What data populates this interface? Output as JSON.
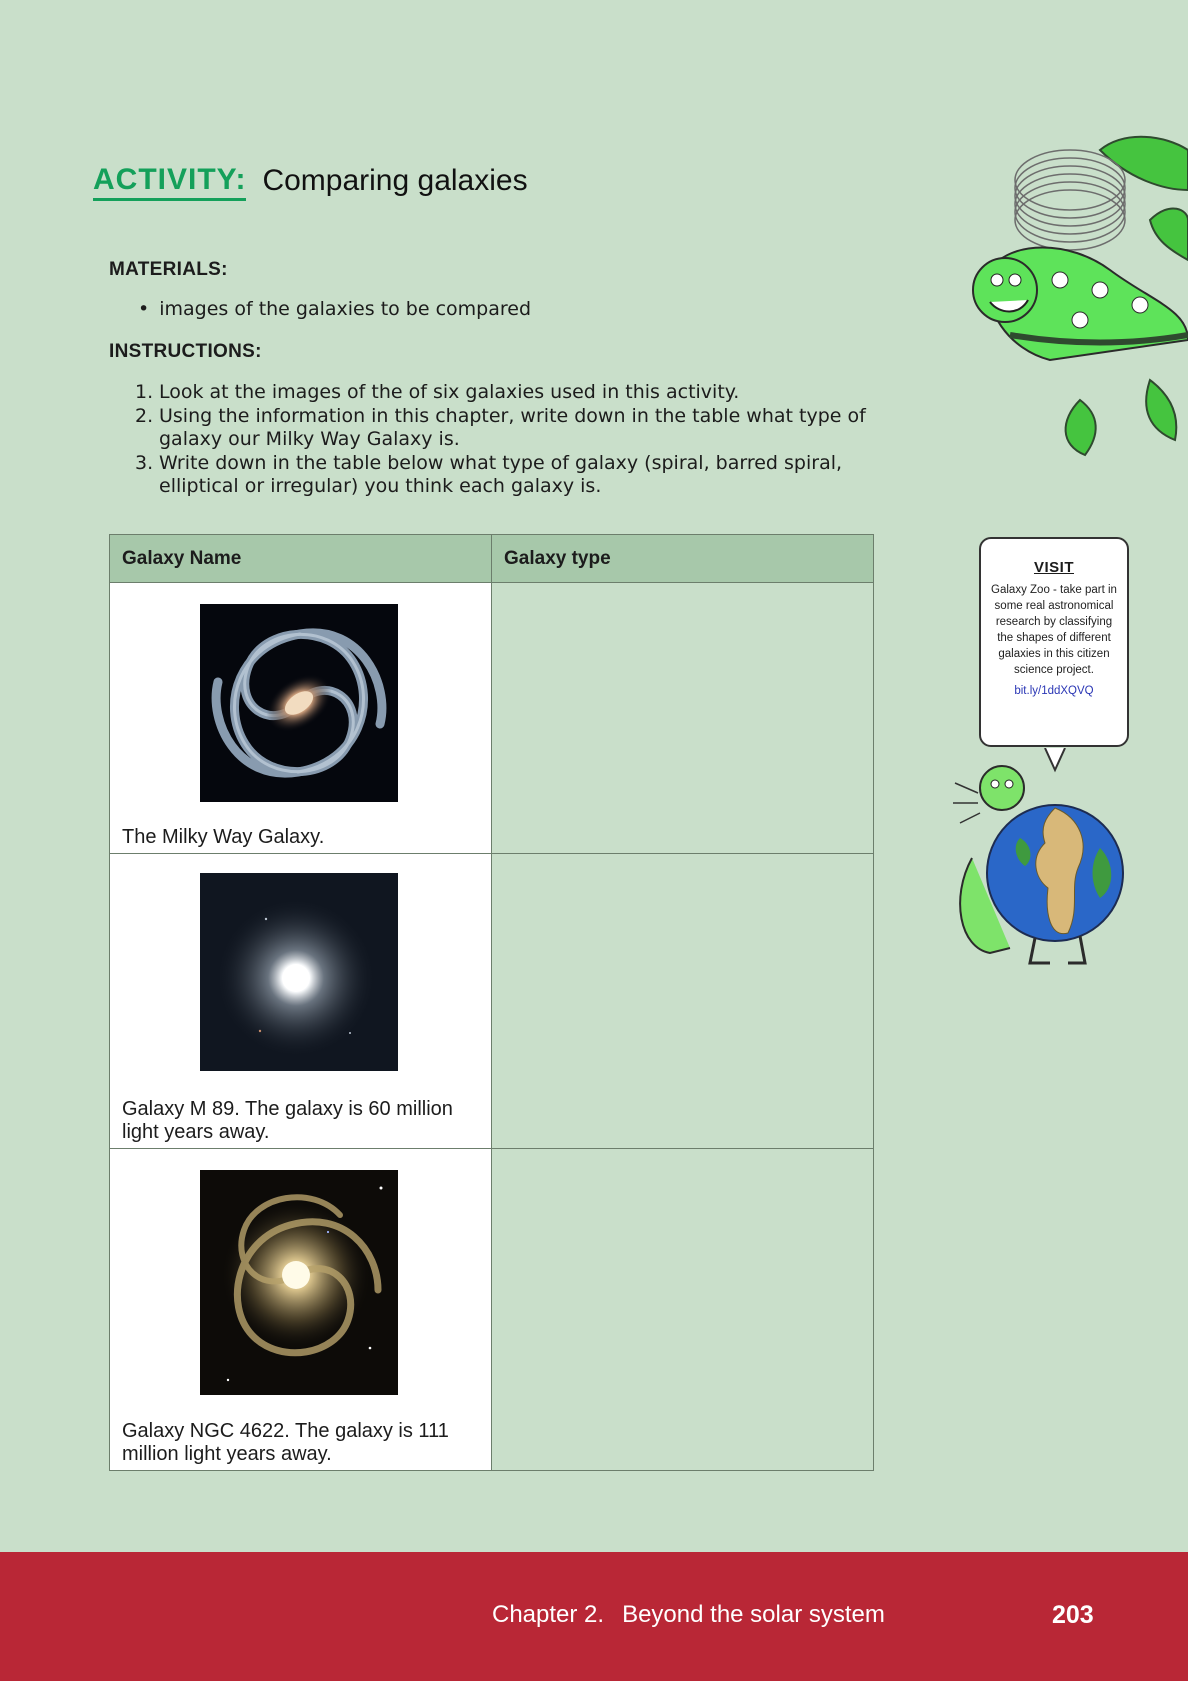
{
  "activity": {
    "kicker": "ACTIVITY:",
    "title": "Comparing galaxies"
  },
  "materials": {
    "heading": "MATERIALS:",
    "items": [
      "images of the galaxies to be compared"
    ]
  },
  "instructions": {
    "heading": "INSTRUCTIONS:",
    "steps": [
      {
        "num": "1.",
        "text": "Look at the images of the of six galaxies used in this activity."
      },
      {
        "num": "2.",
        "text": "Using the information in this chapter, write down in the table what type of galaxy our Milky Way Galaxy is."
      },
      {
        "num": "3.",
        "text": "Write down in the table below what type of galaxy (spiral, barred spiral, elliptical or irregular) you think each galaxy is."
      }
    ]
  },
  "table": {
    "headers": [
      "Galaxy Name",
      "Galaxy type"
    ],
    "rows": [
      {
        "caption": "The Milky Way Galaxy.",
        "type": ""
      },
      {
        "caption": "Galaxy M 89. The galaxy is 60 million light years away.",
        "type": ""
      },
      {
        "caption": "Galaxy NGC 4622. The galaxy is 111 million light years away.",
        "type": ""
      }
    ]
  },
  "sidebar": {
    "visit_title": "VISIT",
    "visit_text": "Galaxy Zoo - take part in some real astronomical research by classifying the shapes of different galaxies in this citizen science project.",
    "visit_link": "bit.ly/1ddXQVQ"
  },
  "footer": {
    "chapter_number": "Chapter 2.",
    "chapter_title": "Beyond the solar system",
    "page_number": "203"
  },
  "colors": {
    "page_background": "#c9dfca",
    "activity_green": "#14a05a",
    "table_header": "#a7c8aa",
    "footer_red": "#b92736",
    "link_blue": "#2b37b5"
  }
}
